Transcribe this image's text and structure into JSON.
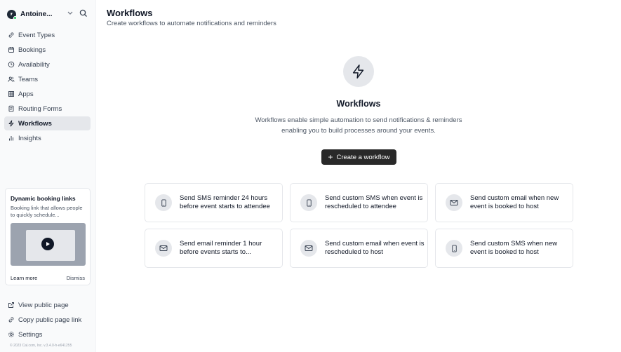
{
  "sidebar": {
    "user_name": "Antoine...",
    "nav": [
      {
        "label": "Event Types",
        "icon": "link-icon"
      },
      {
        "label": "Bookings",
        "icon": "calendar-icon"
      },
      {
        "label": "Availability",
        "icon": "clock-icon"
      },
      {
        "label": "Teams",
        "icon": "users-icon"
      },
      {
        "label": "Apps",
        "icon": "grid-icon"
      },
      {
        "label": "Routing Forms",
        "icon": "file-text-icon"
      },
      {
        "label": "Workflows",
        "icon": "zap-icon",
        "active": true
      },
      {
        "label": "Insights",
        "icon": "bar-chart-icon"
      }
    ],
    "promo": {
      "title": "Dynamic booking links",
      "text": "Booking link that allows people to quickly schedule...",
      "learn_more": "Learn more",
      "dismiss": "Dismiss"
    },
    "bottom_nav": [
      {
        "label": "View public page",
        "icon": "external-link-icon"
      },
      {
        "label": "Copy public page link",
        "icon": "copy-icon"
      },
      {
        "label": "Settings",
        "icon": "settings-icon"
      }
    ],
    "copyright": "© 2023 Cal.com, Inc. v.3.4.0-h-e641255"
  },
  "header": {
    "title": "Workflows",
    "subtitle": "Create workflows to automate notifications and reminders"
  },
  "empty_state": {
    "icon": "zap-icon",
    "title": "Workflows",
    "description": "Workflows enable simple automation to send notifications & reminders enabling you to build processes around your events.",
    "button_label": "Create a workflow"
  },
  "templates": [
    {
      "text": "Send SMS reminder 24 hours before event starts to attendee",
      "icon": "smartphone-icon"
    },
    {
      "text": "Send custom SMS when event is rescheduled to attendee",
      "icon": "smartphone-icon"
    },
    {
      "text": "Send custom email when new event is booked to host",
      "icon": "mail-icon"
    },
    {
      "text": "Send email reminder 1 hour before events starts to...",
      "icon": "mail-icon"
    },
    {
      "text": "Send custom email when event is rescheduled to host",
      "icon": "mail-icon"
    },
    {
      "text": "Send custom SMS when new event is booked to host",
      "icon": "smartphone-icon"
    }
  ],
  "colors": {
    "accent": "#292929",
    "sidebar_bg": "#f9fafb",
    "active_nav_bg": "#e5e7eb",
    "status_online": "#22c55e"
  }
}
